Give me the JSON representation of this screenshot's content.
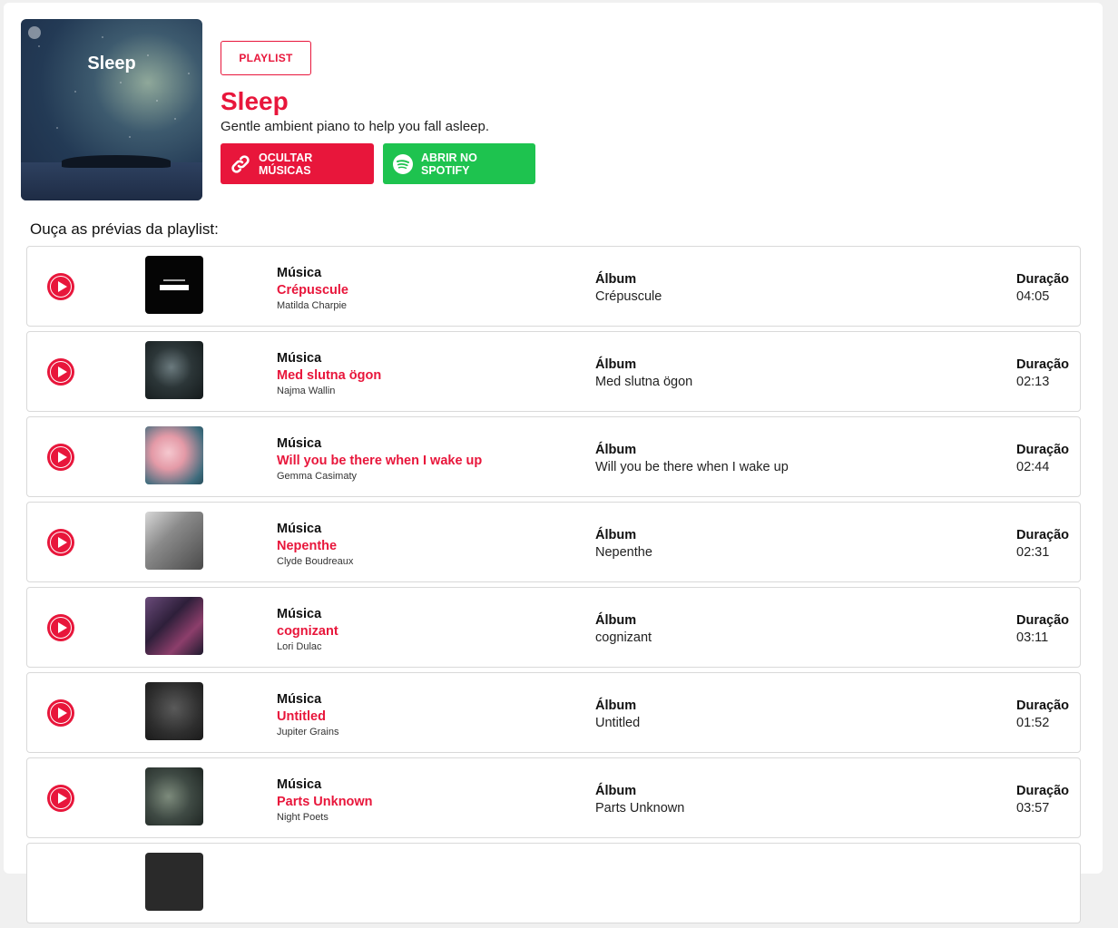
{
  "playlist": {
    "cover_title": "Sleep",
    "badge": "PLAYLIST",
    "title": "Sleep",
    "description": "Gentle ambient piano to help you fall asleep.",
    "hide_button": "OCULTAR MÚSICAS",
    "spotify_button": "ABRIR NO SPOTIFY"
  },
  "preview_heading": "Ouça as prévias da playlist:",
  "labels": {
    "track": "Música",
    "album": "Álbum",
    "duration": "Duração"
  },
  "colors": {
    "accent": "#e8163b",
    "spotify_green": "#1ec34f"
  },
  "tracks": [
    {
      "title": "Crépuscule",
      "artist": "Matilda Charpie",
      "album": "Crépuscule",
      "duration": "04:05"
    },
    {
      "title": "Med slutna ögon",
      "artist": "Najma Wallin",
      "album": "Med slutna ögon",
      "duration": "02:13"
    },
    {
      "title": "Will you be there when I wake up",
      "artist": "Gemma Casimaty",
      "album": "Will you be there when I wake up",
      "duration": "02:44"
    },
    {
      "title": "Nepenthe",
      "artist": "Clyde Boudreaux",
      "album": "Nepenthe",
      "duration": "02:31"
    },
    {
      "title": "cognizant",
      "artist": "Lori Dulac",
      "album": "cognizant",
      "duration": "03:11"
    },
    {
      "title": "Untitled",
      "artist": "Jupiter Grains",
      "album": "Untitled",
      "duration": "01:52"
    },
    {
      "title": "Parts Unknown",
      "artist": "Night Poets",
      "album": "Parts Unknown",
      "duration": "03:57"
    }
  ]
}
